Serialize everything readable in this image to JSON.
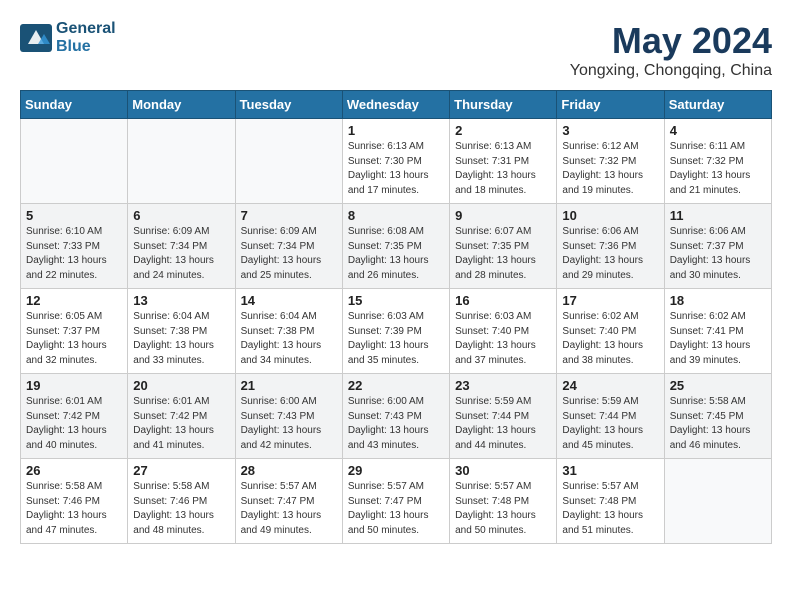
{
  "header": {
    "logo_line1": "General",
    "logo_line2": "Blue",
    "month": "May 2024",
    "location": "Yongxing, Chongqing, China"
  },
  "days_of_week": [
    "Sunday",
    "Monday",
    "Tuesday",
    "Wednesday",
    "Thursday",
    "Friday",
    "Saturday"
  ],
  "weeks": [
    [
      {
        "day": "",
        "info": ""
      },
      {
        "day": "",
        "info": ""
      },
      {
        "day": "",
        "info": ""
      },
      {
        "day": "1",
        "info": "Sunrise: 6:13 AM\nSunset: 7:30 PM\nDaylight: 13 hours\nand 17 minutes."
      },
      {
        "day": "2",
        "info": "Sunrise: 6:13 AM\nSunset: 7:31 PM\nDaylight: 13 hours\nand 18 minutes."
      },
      {
        "day": "3",
        "info": "Sunrise: 6:12 AM\nSunset: 7:32 PM\nDaylight: 13 hours\nand 19 minutes."
      },
      {
        "day": "4",
        "info": "Sunrise: 6:11 AM\nSunset: 7:32 PM\nDaylight: 13 hours\nand 21 minutes."
      }
    ],
    [
      {
        "day": "5",
        "info": "Sunrise: 6:10 AM\nSunset: 7:33 PM\nDaylight: 13 hours\nand 22 minutes."
      },
      {
        "day": "6",
        "info": "Sunrise: 6:09 AM\nSunset: 7:34 PM\nDaylight: 13 hours\nand 24 minutes."
      },
      {
        "day": "7",
        "info": "Sunrise: 6:09 AM\nSunset: 7:34 PM\nDaylight: 13 hours\nand 25 minutes."
      },
      {
        "day": "8",
        "info": "Sunrise: 6:08 AM\nSunset: 7:35 PM\nDaylight: 13 hours\nand 26 minutes."
      },
      {
        "day": "9",
        "info": "Sunrise: 6:07 AM\nSunset: 7:35 PM\nDaylight: 13 hours\nand 28 minutes."
      },
      {
        "day": "10",
        "info": "Sunrise: 6:06 AM\nSunset: 7:36 PM\nDaylight: 13 hours\nand 29 minutes."
      },
      {
        "day": "11",
        "info": "Sunrise: 6:06 AM\nSunset: 7:37 PM\nDaylight: 13 hours\nand 30 minutes."
      }
    ],
    [
      {
        "day": "12",
        "info": "Sunrise: 6:05 AM\nSunset: 7:37 PM\nDaylight: 13 hours\nand 32 minutes."
      },
      {
        "day": "13",
        "info": "Sunrise: 6:04 AM\nSunset: 7:38 PM\nDaylight: 13 hours\nand 33 minutes."
      },
      {
        "day": "14",
        "info": "Sunrise: 6:04 AM\nSunset: 7:38 PM\nDaylight: 13 hours\nand 34 minutes."
      },
      {
        "day": "15",
        "info": "Sunrise: 6:03 AM\nSunset: 7:39 PM\nDaylight: 13 hours\nand 35 minutes."
      },
      {
        "day": "16",
        "info": "Sunrise: 6:03 AM\nSunset: 7:40 PM\nDaylight: 13 hours\nand 37 minutes."
      },
      {
        "day": "17",
        "info": "Sunrise: 6:02 AM\nSunset: 7:40 PM\nDaylight: 13 hours\nand 38 minutes."
      },
      {
        "day": "18",
        "info": "Sunrise: 6:02 AM\nSunset: 7:41 PM\nDaylight: 13 hours\nand 39 minutes."
      }
    ],
    [
      {
        "day": "19",
        "info": "Sunrise: 6:01 AM\nSunset: 7:42 PM\nDaylight: 13 hours\nand 40 minutes."
      },
      {
        "day": "20",
        "info": "Sunrise: 6:01 AM\nSunset: 7:42 PM\nDaylight: 13 hours\nand 41 minutes."
      },
      {
        "day": "21",
        "info": "Sunrise: 6:00 AM\nSunset: 7:43 PM\nDaylight: 13 hours\nand 42 minutes."
      },
      {
        "day": "22",
        "info": "Sunrise: 6:00 AM\nSunset: 7:43 PM\nDaylight: 13 hours\nand 43 minutes."
      },
      {
        "day": "23",
        "info": "Sunrise: 5:59 AM\nSunset: 7:44 PM\nDaylight: 13 hours\nand 44 minutes."
      },
      {
        "day": "24",
        "info": "Sunrise: 5:59 AM\nSunset: 7:44 PM\nDaylight: 13 hours\nand 45 minutes."
      },
      {
        "day": "25",
        "info": "Sunrise: 5:58 AM\nSunset: 7:45 PM\nDaylight: 13 hours\nand 46 minutes."
      }
    ],
    [
      {
        "day": "26",
        "info": "Sunrise: 5:58 AM\nSunset: 7:46 PM\nDaylight: 13 hours\nand 47 minutes."
      },
      {
        "day": "27",
        "info": "Sunrise: 5:58 AM\nSunset: 7:46 PM\nDaylight: 13 hours\nand 48 minutes."
      },
      {
        "day": "28",
        "info": "Sunrise: 5:57 AM\nSunset: 7:47 PM\nDaylight: 13 hours\nand 49 minutes."
      },
      {
        "day": "29",
        "info": "Sunrise: 5:57 AM\nSunset: 7:47 PM\nDaylight: 13 hours\nand 50 minutes."
      },
      {
        "day": "30",
        "info": "Sunrise: 5:57 AM\nSunset: 7:48 PM\nDaylight: 13 hours\nand 50 minutes."
      },
      {
        "day": "31",
        "info": "Sunrise: 5:57 AM\nSunset: 7:48 PM\nDaylight: 13 hours\nand 51 minutes."
      },
      {
        "day": "",
        "info": ""
      }
    ]
  ]
}
